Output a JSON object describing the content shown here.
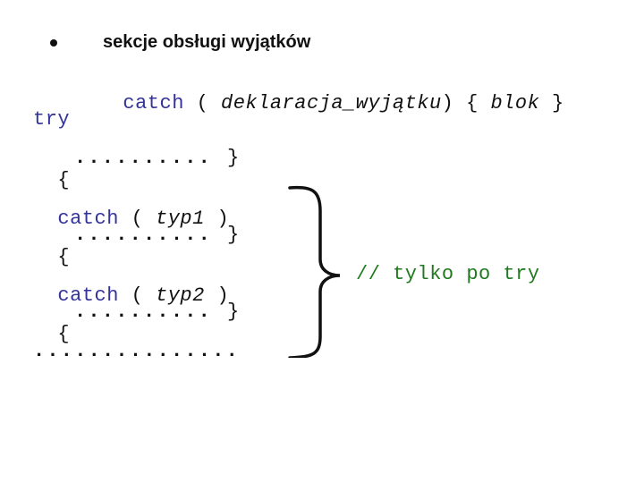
{
  "bullet": {
    "heading": "sekcje obsługi wyjątków"
  },
  "syntax": {
    "keyword": "catch",
    "open_paren": "(",
    "param": "deklaracja_wyjątku",
    "close_paren": ")",
    "open_brace": "{",
    "body": "blok",
    "close_brace": "}"
  },
  "example": {
    "try_keyword": "try",
    "blocks": [
      {
        "open": "{",
        "dots": "..........",
        "close": "}"
      },
      {
        "open": "{",
        "dots": "..........",
        "close": "}"
      },
      {
        "open": "{",
        "dots": "..........",
        "close": "}"
      }
    ],
    "catches": [
      {
        "keyword": "catch",
        "open": "(",
        "type": "typ1",
        "close": ")"
      },
      {
        "keyword": "catch",
        "open": "(",
        "type": "typ2",
        "close": ")"
      }
    ],
    "ellipsis": "..............."
  },
  "annotation": {
    "comment": "// tylko po try"
  },
  "colors": {
    "keyword": "#333399",
    "comment": "#1f7a1f",
    "text": "#111111"
  }
}
